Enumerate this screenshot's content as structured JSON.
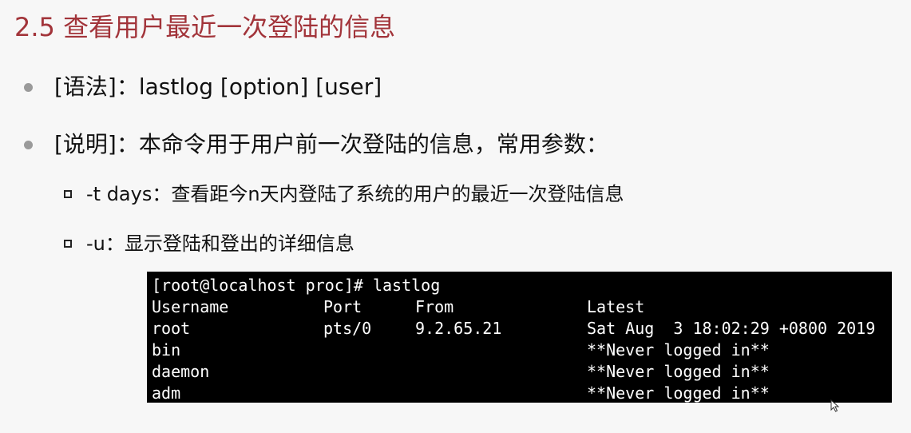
{
  "title": "2.5 查看用户最近一次登陆的信息",
  "bullets": [
    "[语法]：lastlog [option] [user]",
    "[说明]：本命令用于用户前一次登陆的信息，常用参数："
  ],
  "sub_bullets": [
    "-t  days：查看距今n天内登陆了系统的用户的最近一次登陆信息",
    "-u：显示登陆和登出的详细信息"
  ],
  "terminal": {
    "prompt_line": "[root@localhost proc]# lastlog",
    "headers": [
      "Username",
      "Port",
      "From",
      "Latest"
    ],
    "rows": [
      [
        "root",
        "pts/0",
        "9.2.65.21",
        "Sat Aug  3 18:02:29 +0800 2019"
      ],
      [
        "bin",
        "",
        "",
        "**Never logged in**"
      ],
      [
        "daemon",
        "",
        "",
        "**Never logged in**"
      ],
      [
        "adm",
        "",
        "",
        "**Never logged in**"
      ]
    ]
  },
  "colors": {
    "title": "#a2343a",
    "terminal_bg": "#000000",
    "terminal_fg": "#ffffff",
    "bullet": "#9a9a9a"
  },
  "icons": {
    "mouse_cursor": "mouse-pointer-icon"
  }
}
